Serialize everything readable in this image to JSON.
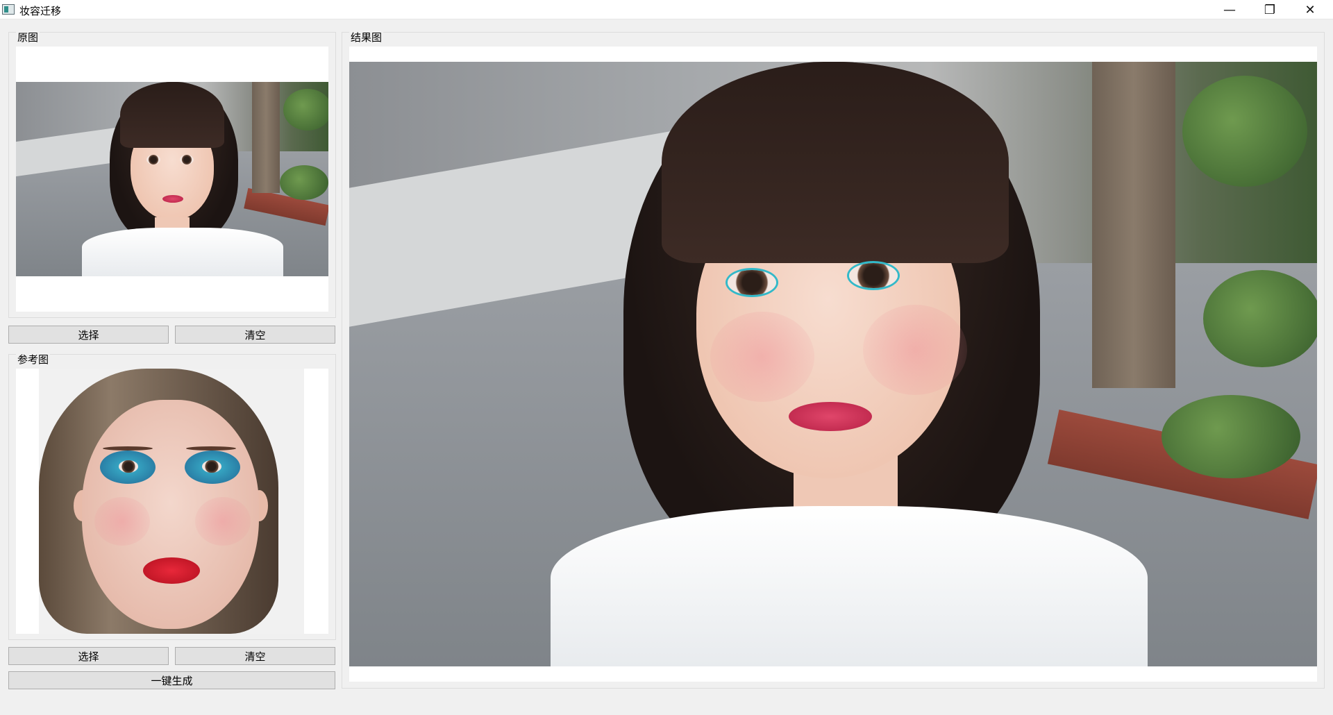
{
  "window": {
    "title": "妆容迁移",
    "controls": {
      "minimize": "—",
      "maximize": "❐",
      "close": "✕"
    }
  },
  "left_panel": {
    "source_group": {
      "title": "原图",
      "select_label": "选择",
      "clear_label": "清空"
    },
    "reference_group": {
      "title": "参考图",
      "select_label": "选择",
      "clear_label": "清空"
    },
    "generate_label": "一键生成"
  },
  "result_panel": {
    "title": "结果图"
  },
  "colors": {
    "window_bg": "#f0f0f0",
    "button_bg": "#e1e1e1",
    "button_border": "#adadad",
    "group_border": "#dcdcdc"
  },
  "icons": {
    "app": "app-icon",
    "minimize": "minimize-icon",
    "maximize": "restore-icon",
    "close": "close-icon"
  }
}
